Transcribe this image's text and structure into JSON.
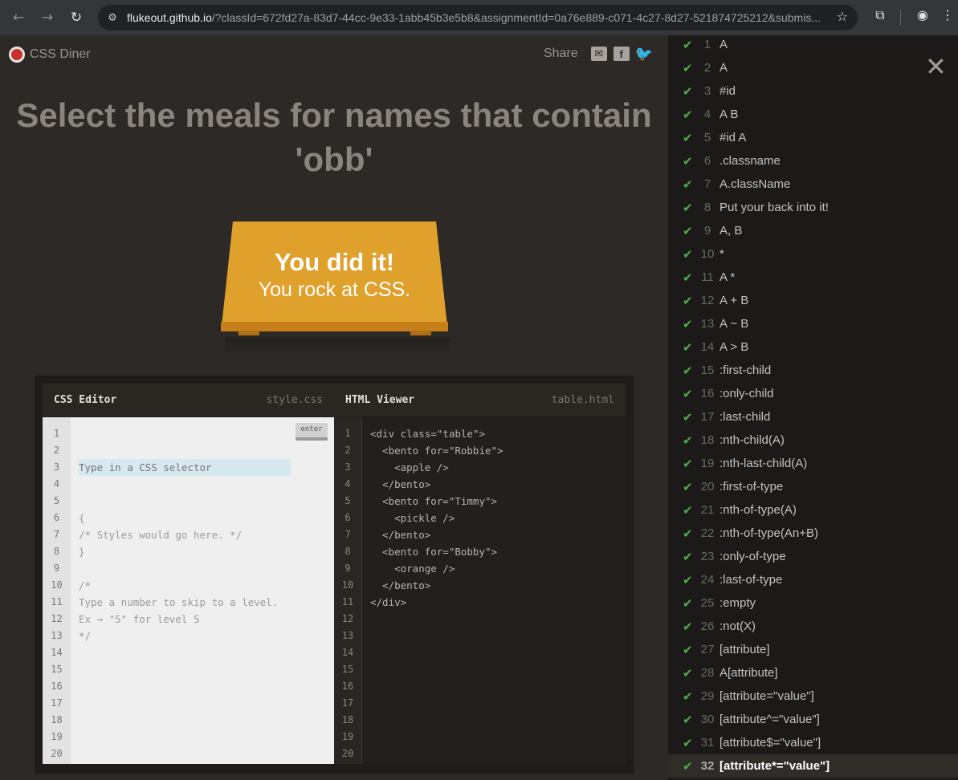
{
  "browser": {
    "back_icon": "←",
    "forward_icon": "→",
    "reload_icon": "↻",
    "site_info_icon": "⚙",
    "url_host": "flukeout.github.io",
    "url_rest": "/?classId=672fd27a-83d7-44cc-9e33-1abb45b3e5b8&assignmentId=0a76e889-c071-4c27-8d27-521874725212&submis...",
    "star_icon": "☆",
    "extensions_icon": "⧉",
    "profile_icon": "◉",
    "menu_icon": "⋮"
  },
  "header": {
    "app_name": "CSS Diner",
    "share_label": "Share",
    "mail_icon": "✉",
    "facebook_icon": "f",
    "twitter_icon": "🐦"
  },
  "level_heading": "Select the meals for names that contain 'obb'",
  "table": {
    "win_line1": "You did it!",
    "win_line2": "You rock at CSS."
  },
  "css_editor": {
    "title": "CSS Editor",
    "filename": "style.css",
    "placeholder": "Type in a CSS selector",
    "enter_label": "enter",
    "lines": [
      "{",
      "/* Styles would go here. */",
      "}",
      "",
      "/*",
      "Type a number to skip to a level.",
      "Ex → \"5\" for level 5",
      "*/"
    ],
    "line_numbers": [
      "1",
      "2",
      "3",
      "4",
      "5",
      "6",
      "7",
      "8",
      "9",
      "10",
      "11",
      "12",
      "13",
      "14",
      "15",
      "16",
      "17",
      "18",
      "19",
      "20"
    ]
  },
  "html_viewer": {
    "title": "HTML Viewer",
    "filename": "table.html",
    "code": "<div class=\"table\">\n  <bento for=\"Robbie\">\n    <apple />\n  </bento>\n  <bento for=\"Timmy\">\n    <pickle />\n  </bento>\n  <bento for=\"Bobby\">\n    <orange />\n  </bento>\n</div>",
    "line_numbers": [
      "1",
      "2",
      "3",
      "4",
      "5",
      "6",
      "7",
      "8",
      "9",
      "10",
      "11",
      "12",
      "13",
      "14",
      "15",
      "16",
      "17",
      "18",
      "19",
      "20"
    ]
  },
  "levels_panel": {
    "close_icon": "✕",
    "check_icon": "✔",
    "current_level": 32,
    "levels": [
      {
        "num": "1",
        "name": "A"
      },
      {
        "num": "2",
        "name": "A"
      },
      {
        "num": "3",
        "name": "#id"
      },
      {
        "num": "4",
        "name": "A  B"
      },
      {
        "num": "5",
        "name": "#id  A"
      },
      {
        "num": "6",
        "name": ".classname"
      },
      {
        "num": "7",
        "name": "A.className"
      },
      {
        "num": "8",
        "name": "Put your back into it!"
      },
      {
        "num": "9",
        "name": "A, B"
      },
      {
        "num": "10",
        "name": "*"
      },
      {
        "num": "11",
        "name": "A  *"
      },
      {
        "num": "12",
        "name": "A + B"
      },
      {
        "num": "13",
        "name": "A ~ B"
      },
      {
        "num": "14",
        "name": "A > B"
      },
      {
        "num": "15",
        "name": ":first-child"
      },
      {
        "num": "16",
        "name": ":only-child"
      },
      {
        "num": "17",
        "name": ":last-child"
      },
      {
        "num": "18",
        "name": ":nth-child(A)"
      },
      {
        "num": "19",
        "name": ":nth-last-child(A)"
      },
      {
        "num": "20",
        "name": ":first-of-type"
      },
      {
        "num": "21",
        "name": ":nth-of-type(A)"
      },
      {
        "num": "22",
        "name": ":nth-of-type(An+B)"
      },
      {
        "num": "23",
        "name": ":only-of-type"
      },
      {
        "num": "24",
        "name": ":last-of-type"
      },
      {
        "num": "25",
        "name": ":empty"
      },
      {
        "num": "26",
        "name": ":not(X)"
      },
      {
        "num": "27",
        "name": "[attribute]"
      },
      {
        "num": "28",
        "name": "A[attribute]"
      },
      {
        "num": "29",
        "name": "[attribute=\"value\"]"
      },
      {
        "num": "30",
        "name": "[attribute^=\"value\"]"
      },
      {
        "num": "31",
        "name": "[attribute$=\"value\"]"
      },
      {
        "num": "32",
        "name": "[attribute*=\"value\"]"
      }
    ]
  }
}
